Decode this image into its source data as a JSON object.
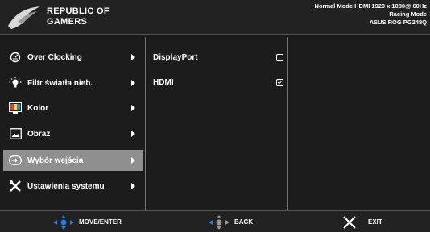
{
  "header": {
    "brand_line1": "REPUBLIC OF",
    "brand_line2": "GAMERS",
    "status_line1": "Normal Mode HDMI 1920 x 1080@ 60Hz",
    "status_line2": "Racing Mode",
    "status_line3": "ASUS ROG PG248Q"
  },
  "menu": {
    "items": [
      {
        "label": "Over Clocking",
        "icon": "speedometer-icon"
      },
      {
        "label": "Filtr światła nieb.",
        "icon": "light-bulb-icon"
      },
      {
        "label": "Kolor",
        "icon": "color-icon"
      },
      {
        "label": "Obraz",
        "icon": "image-icon"
      },
      {
        "label": "Wybór wejścia",
        "icon": "input-icon",
        "selected": true
      },
      {
        "label": "Ustawienia systemu",
        "icon": "tools-icon"
      }
    ]
  },
  "submenu": {
    "items": [
      {
        "label": "DisplayPort",
        "checked": false
      },
      {
        "label": "HDMI",
        "checked": true
      }
    ]
  },
  "footer": {
    "move_label": "MOVE/ENTER",
    "back_label": "BACK",
    "exit_label": "EXIT"
  },
  "colors": {
    "background": "#1c1c1c",
    "selected": "#8f8f8f",
    "accent_blue": "#2a7bd8"
  }
}
